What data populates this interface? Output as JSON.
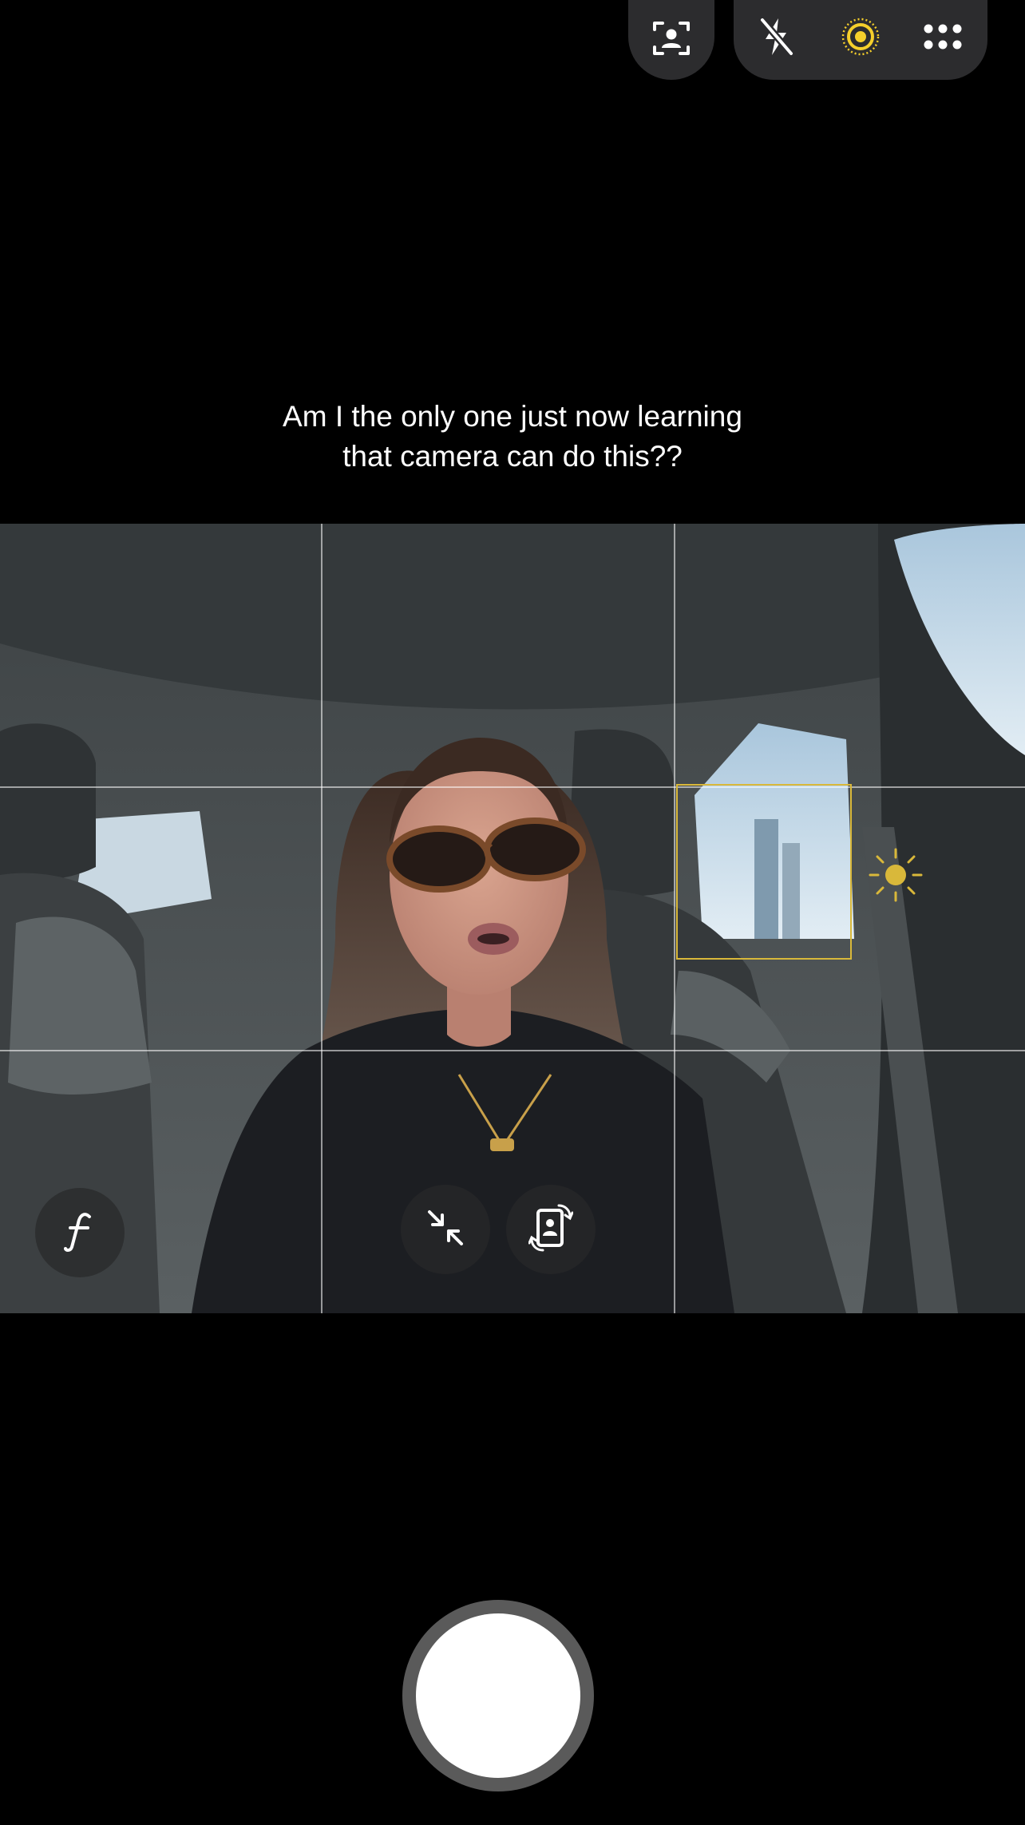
{
  "top_bar": {
    "left_control": {
      "icon": "portrait-frame-icon"
    },
    "controls": [
      {
        "icon": "flash-off-icon"
      },
      {
        "icon": "live-photo-icon",
        "active": true,
        "color": "#f5cf2b"
      },
      {
        "icon": "more-dots-icon"
      }
    ]
  },
  "caption": {
    "line1": "Am I the only one just now learning",
    "line2": "that camera can do this??"
  },
  "viewfinder": {
    "grid": true,
    "focus_box_color": "#d9b83a",
    "exposure_icon": "sun-icon",
    "buttons": [
      {
        "icon": "aperture-f-icon"
      },
      {
        "icon": "collapse-arrows-icon"
      },
      {
        "icon": "rotate-selfie-icon"
      }
    ]
  },
  "shutter": {
    "icon": "shutter-button"
  }
}
